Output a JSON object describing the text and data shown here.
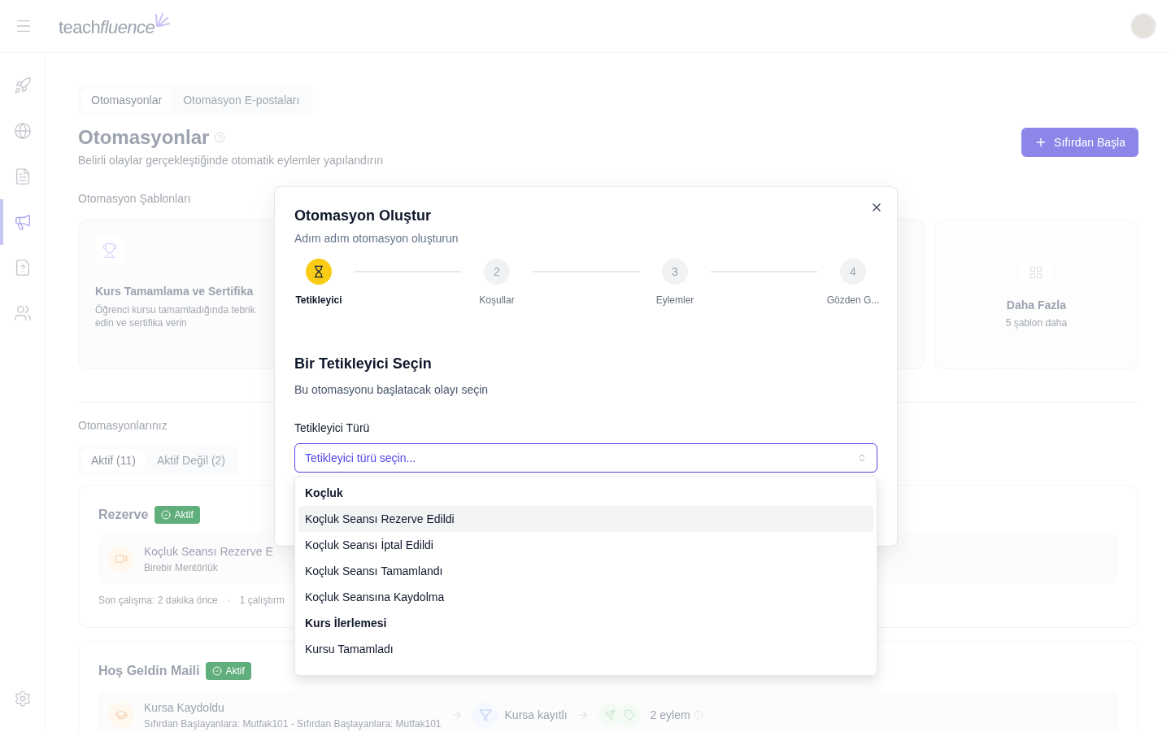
{
  "header": {
    "logo": {
      "part_1": "teach",
      "part_2": "fluence"
    }
  },
  "sidebar": {
    "items": [
      {
        "selected": false
      },
      {
        "selected": false
      },
      {
        "selected": false
      },
      {
        "selected": true
      },
      {
        "selected": false
      },
      {
        "selected": false
      }
    ]
  },
  "page": {
    "tabs": [
      {
        "label": "Otomasyonlar",
        "selected": true
      },
      {
        "label": "Otomasyon E-postaları",
        "selected": false
      }
    ],
    "title": "Otomasyonlar",
    "subtitle": "Belirli olaylar gerçekleştiğinde otomatik eylemler yapılandırın",
    "primary_button": "Sıfırdan Başla",
    "templates_heading": "Otomasyon Şablonları",
    "template": {
      "title": "Kurs Tamamlama ve Sertifika",
      "description": "Öğrenci kursu tamamladığında tebrik edin ve sertifika verin"
    },
    "more_card": {
      "title": "Daha Fazla",
      "subtitle": "5 şablon daha"
    },
    "automations_heading": "Otomasyonlarınız",
    "filter_tabs": [
      {
        "label": "Aktif (11)",
        "selected": true
      },
      {
        "label": "Aktif Değil (2)",
        "selected": false
      }
    ],
    "automations": [
      {
        "name": "Rezerve",
        "status": "Aktif",
        "trigger_title": "Koçluk Seansı Rezerve E",
        "trigger_subtitle": "Birebir Mentörlük",
        "footer": [
          "Son çalışma: 2 dakika önce",
          "1 çalıştırm"
        ]
      },
      {
        "name": "Hoş Geldin Maili",
        "status": "Aktif",
        "trigger_title": "Kursa Kaydoldu",
        "trigger_subtitle": "Sıfırdan Başlayanlara: Mutfak101 - Sıfırdan Başlayanlara: Mutfak101",
        "condition": "Kursa kayıtlı",
        "actions": "2 eylem"
      }
    ]
  },
  "modal": {
    "title": "Otomasyon Oluştur",
    "subtitle": "Adım adım otomasyon oluşturun",
    "steps": [
      {
        "label": "Tetikleyici",
        "selected": true
      },
      {
        "number": "2",
        "label": "Koşullar",
        "selected": false
      },
      {
        "number": "3",
        "label": "Eylemler",
        "selected": false
      },
      {
        "number": "4",
        "label": "Gözden G...",
        "selected": false
      }
    ],
    "section_title": "Bir Tetikleyici Seçin",
    "section_subtitle": "Bu otomasyonu başlatacak olayı seçin",
    "field": {
      "label": "Tetikleyici Türü",
      "prompt": "Tetikleyici türü seçin...",
      "expanded": true,
      "groups": [
        {
          "label": "Koçluk",
          "options": [
            {
              "label": "Koçluk Seansı Rezerve Edildi",
              "selected": true
            },
            {
              "label": "Koçluk Seansı İptal Edildi",
              "selected": false
            },
            {
              "label": "Koçluk Seansı Tamamlandı",
              "selected": false
            },
            {
              "label": "Koçluk Seansına Kaydolma",
              "selected": false
            }
          ]
        },
        {
          "label": "Kurs İlerlemesi",
          "options": [
            {
              "label": "Kursu Tamamladı",
              "selected": false
            }
          ]
        }
      ]
    }
  }
}
